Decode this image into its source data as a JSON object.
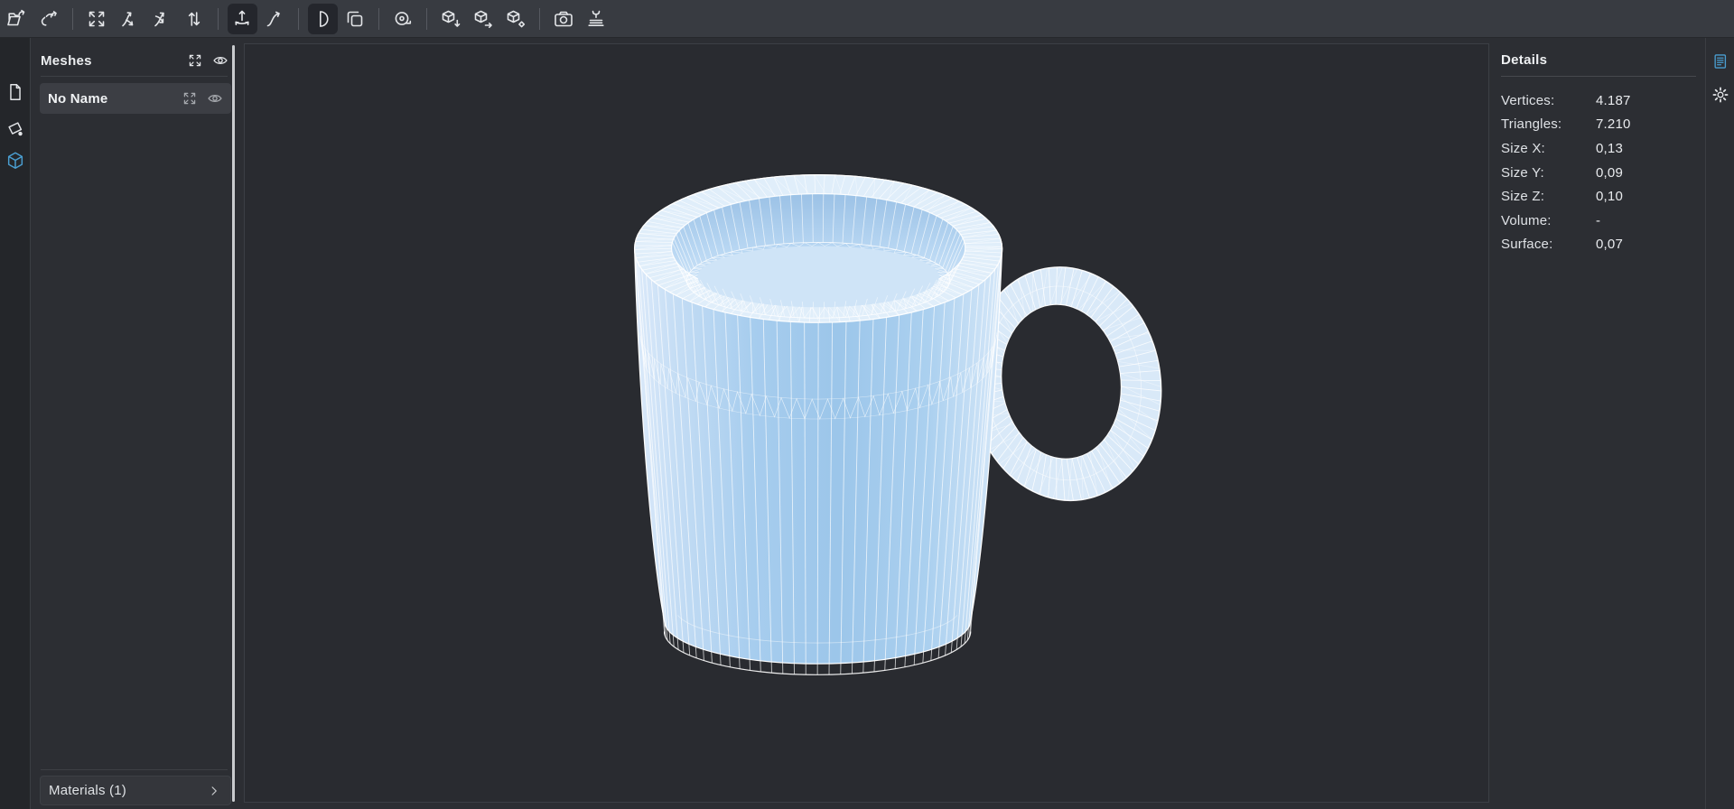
{
  "toolbar": {
    "buttons": [
      {
        "icon": "open-file-icon",
        "active": false
      },
      {
        "icon": "link-import-icon",
        "active": false
      },
      {
        "icon": "fit-view-icon",
        "active": false
      },
      {
        "icon": "split-arrows-icon",
        "active": false
      },
      {
        "icon": "merge-arrows-icon",
        "active": false
      },
      {
        "icon": "swap-vertical-icon",
        "active": false
      },
      {
        "icon": "transform-anchor-icon",
        "active": true
      },
      {
        "icon": "curve-arrow-icon",
        "active": false
      },
      {
        "icon": "clip-plane-icon",
        "active": true
      },
      {
        "icon": "duplicate-icon",
        "active": false
      },
      {
        "icon": "measure-tape-icon",
        "active": false
      },
      {
        "icon": "cube-export-down-icon",
        "active": false
      },
      {
        "icon": "cube-export-right-icon",
        "active": false
      },
      {
        "icon": "cube-export-diamond-icon",
        "active": false
      },
      {
        "icon": "camera-icon",
        "active": false
      },
      {
        "icon": "printer-3d-icon",
        "active": false
      }
    ]
  },
  "left_rail": {
    "items": [
      {
        "icon": "file-icon",
        "active": false
      },
      {
        "icon": "sketch-plane-icon",
        "active": false
      },
      {
        "icon": "cube-icon",
        "active": true
      }
    ]
  },
  "sidebar": {
    "title": "Meshes",
    "rows": [
      {
        "label": "No Name",
        "selected": true
      }
    ],
    "materials": {
      "label": "Materials (1)"
    }
  },
  "details": {
    "title": "Details",
    "rows": [
      {
        "label": "Vertices:",
        "value": "4.187"
      },
      {
        "label": "Triangles:",
        "value": "7.210"
      },
      {
        "label": "Size X:",
        "value": "0,13"
      },
      {
        "label": "Size Y:",
        "value": "0,09"
      },
      {
        "label": "Size Z:",
        "value": "0,10"
      },
      {
        "label": "Volume:",
        "value": "-"
      },
      {
        "label": "Surface:",
        "value": "0,07"
      }
    ]
  },
  "right_rail": {
    "items": [
      {
        "icon": "details-panel-icon",
        "active": true
      },
      {
        "icon": "settings-gear-icon",
        "active": false
      }
    ]
  },
  "viewport": {
    "object": "coffee mug triangle mesh, wireframe shaded"
  },
  "colors": {
    "accent": "#4a9ed1",
    "panel_bg": "#2c2e33",
    "canvas_bg": "#292b30",
    "toolbar_bg": "#383b41",
    "active_button_bg": "#24262c",
    "selected_row_bg": "#3c3e44",
    "mesh_fill": "#a7cdee",
    "mesh_fill_light": "#dceafa",
    "mesh_wire": "#ffffff",
    "rim_fill": "#e0eefa",
    "handle_fill": "#d9e9f8",
    "cavity_top": "#9cc2e6",
    "cavity_bottom": "#d8eafa"
  }
}
